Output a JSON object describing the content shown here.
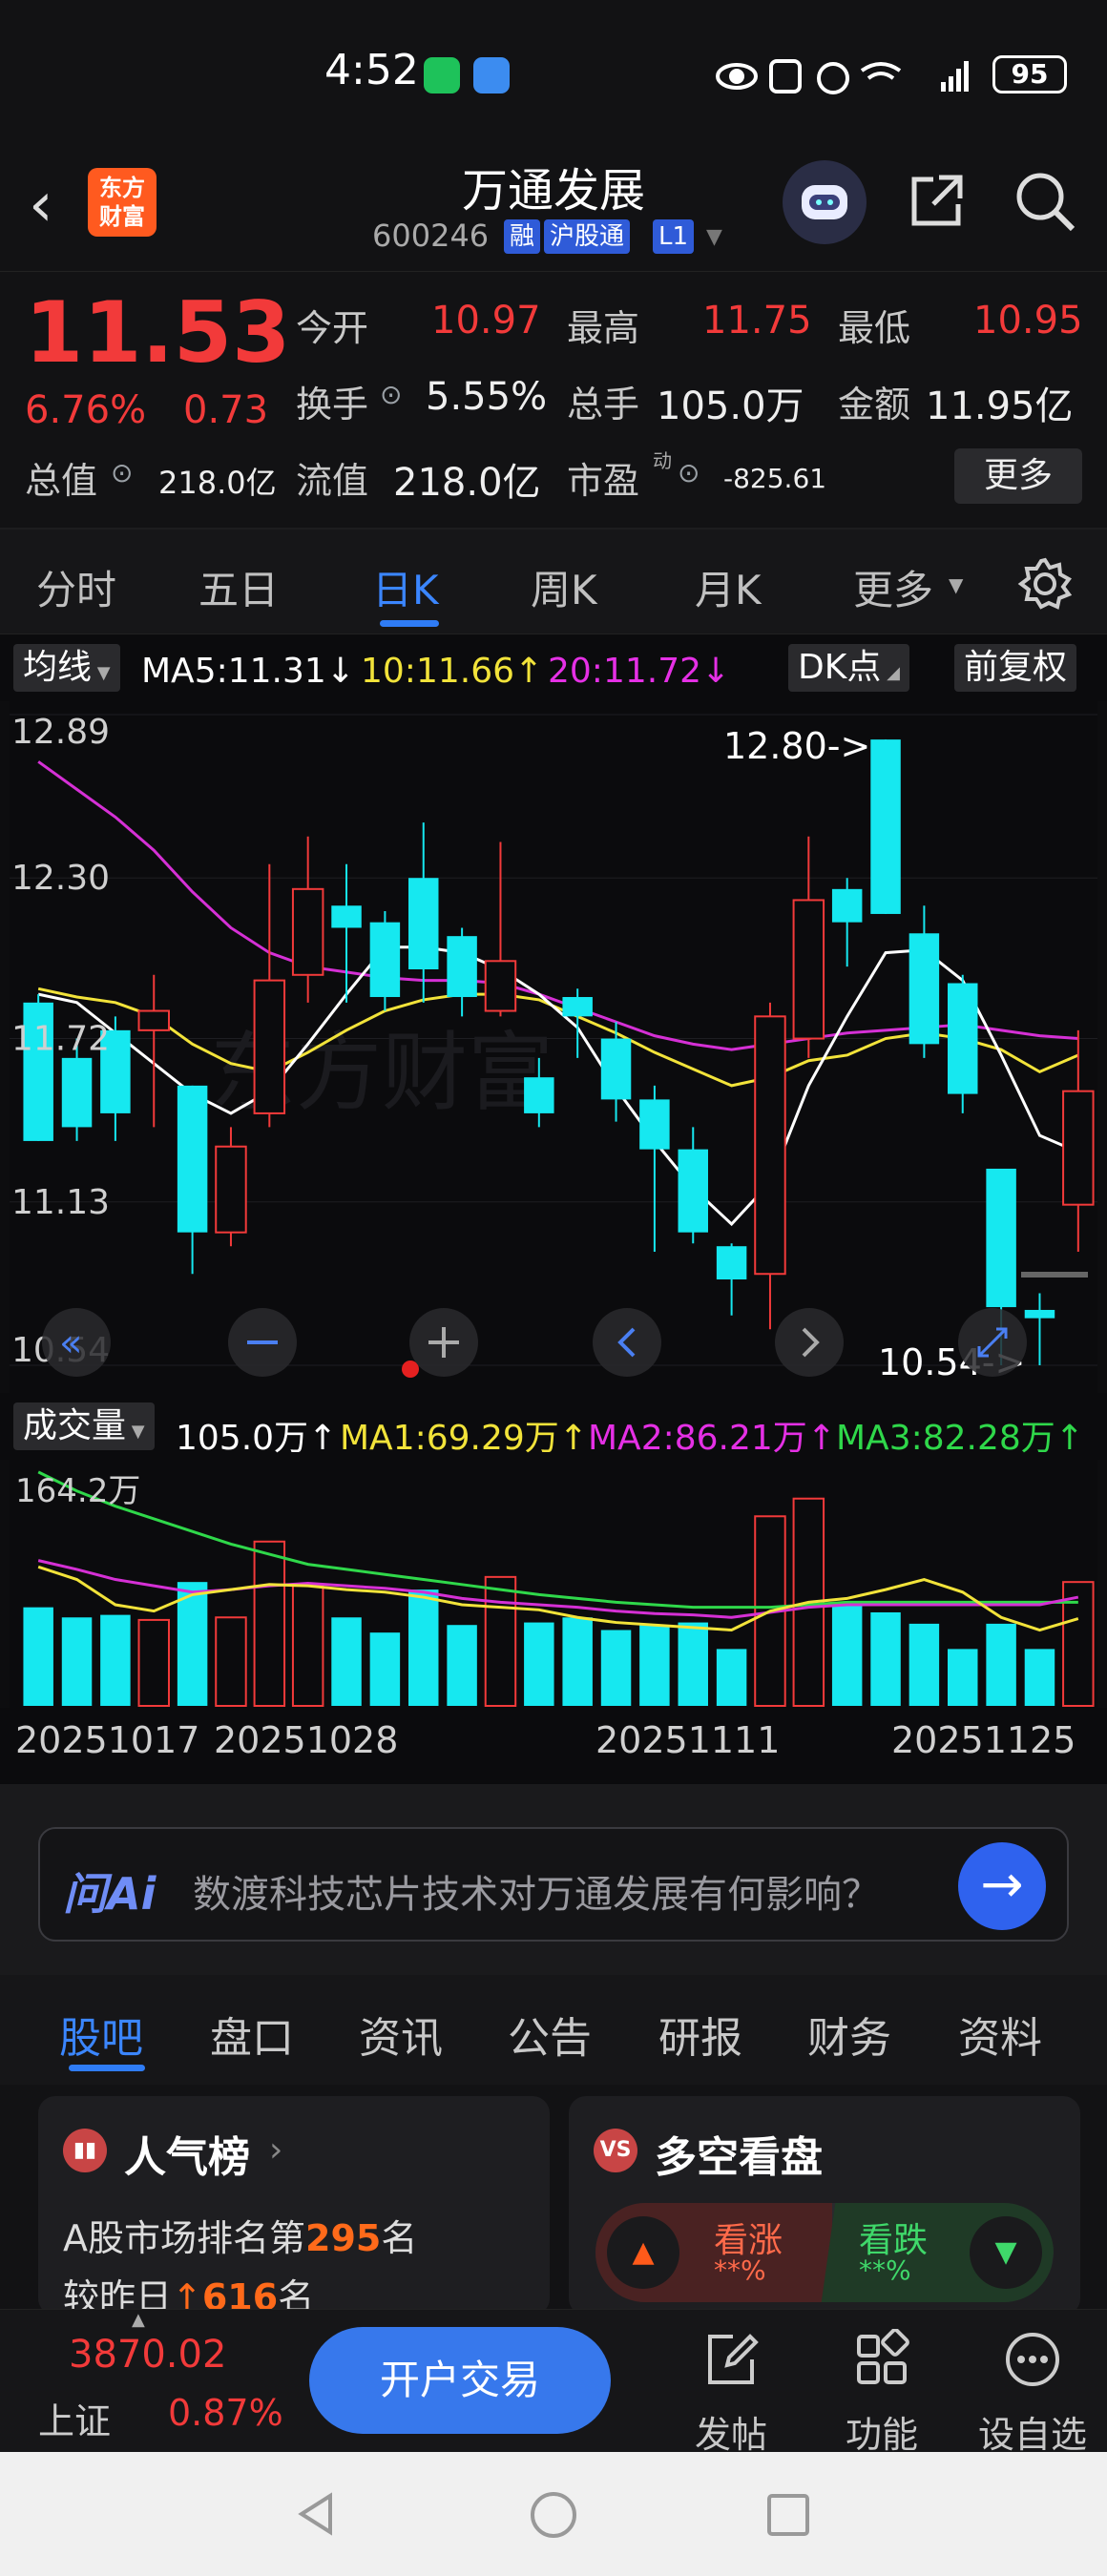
{
  "status_bar": {
    "time": "4:52",
    "battery": "95"
  },
  "header": {
    "logo_line1": "东方",
    "logo_line2": "财富",
    "stock_name": "万通发展",
    "stock_code": "600246",
    "tags": [
      "融",
      "沪股通",
      "L1"
    ]
  },
  "quote": {
    "price": "11.53",
    "change_pct": "6.76%",
    "change": "0.73",
    "open_label": "今开",
    "open": "10.97",
    "high_label": "最高",
    "high": "11.75",
    "low_label": "最低",
    "low": "10.95",
    "turnover_label": "换手",
    "turnover": "5.55%",
    "volume_label": "总手",
    "volume": "105.0万",
    "amount_label": "金额",
    "amount": "11.95亿",
    "mcap_label": "总值",
    "mcap": "218.0亿",
    "float_label": "流值",
    "float_cap": "218.0亿",
    "pe_label": "市盈",
    "pe_sup": "动",
    "pe": "-825.61",
    "more": "更多"
  },
  "period_tabs": [
    "分时",
    "五日",
    "日K",
    "周K",
    "月K",
    "更多"
  ],
  "ma_bar": {
    "selector": "均线",
    "ma5": "MA5:11.31↓",
    "ma10": "10:11.66↑",
    "ma20": "20:11.72↓",
    "dk": "DK点",
    "adjust": "前复权"
  },
  "vol_bar": {
    "selector": "成交量",
    "vol": "105.0万↑",
    "ma1": "MA1:69.29万↑",
    "ma2": "MA2:86.21万↑",
    "ma3": "MA3:82.28万↑"
  },
  "chart_data": {
    "type": "candlestick",
    "y_ticks": [
      "12.89",
      "12.30",
      "11.72",
      "11.13",
      "10.54"
    ],
    "ylim": [
      10.54,
      12.89
    ],
    "annotations": {
      "max_label": "12.80->",
      "min_label": "10.54->"
    },
    "candles": [
      [
        11.85,
        11.35,
        11.88,
        11.35
      ],
      [
        11.65,
        11.4,
        11.72,
        11.35
      ],
      [
        11.75,
        11.45,
        11.8,
        11.35
      ],
      [
        11.75,
        11.82,
        11.95,
        11.4
      ],
      [
        11.55,
        11.02,
        11.55,
        10.87
      ],
      [
        11.02,
        11.33,
        11.4,
        10.97
      ],
      [
        11.45,
        11.93,
        12.35,
        11.4
      ],
      [
        11.95,
        12.26,
        12.45,
        11.85
      ],
      [
        12.2,
        12.12,
        12.35,
        11.85
      ],
      [
        12.14,
        11.87,
        12.18,
        11.82
      ],
      [
        12.3,
        11.97,
        12.5,
        11.85
      ],
      [
        12.09,
        11.87,
        12.12,
        11.8
      ],
      [
        11.82,
        12.0,
        12.43,
        11.8
      ],
      [
        11.58,
        11.45,
        11.65,
        11.4
      ],
      [
        11.87,
        11.8,
        11.9,
        11.65
      ],
      [
        11.72,
        11.5,
        11.78,
        11.42
      ],
      [
        11.5,
        11.32,
        11.55,
        10.95
      ],
      [
        11.32,
        11.02,
        11.4,
        10.98
      ],
      [
        10.97,
        10.85,
        10.98,
        10.72
      ],
      [
        10.87,
        11.8,
        11.85,
        10.67
      ],
      [
        11.72,
        12.22,
        12.45,
        11.65
      ],
      [
        12.26,
        12.14,
        12.3,
        11.98
      ],
      [
        12.8,
        12.17,
        12.8,
        12.17
      ],
      [
        12.1,
        11.7,
        12.2,
        11.65
      ],
      [
        11.92,
        11.52,
        11.95,
        11.45
      ],
      [
        11.25,
        10.75,
        11.25,
        10.54
      ],
      [
        10.74,
        10.71,
        10.8,
        10.54
      ],
      [
        11.12,
        11.53,
        11.75,
        10.95
      ]
    ],
    "ma5": [
      11.88,
      11.85,
      11.74,
      11.63,
      11.52,
      11.45,
      11.53,
      11.7,
      11.88,
      12.05,
      12.05,
      12.03,
      11.97,
      11.88,
      11.76,
      11.54,
      11.35,
      11.18,
      11.05,
      11.2,
      11.55,
      11.8,
      12.03,
      12.04,
      11.93,
      11.66,
      11.37,
      11.31
    ],
    "ma10": [
      11.9,
      11.87,
      11.85,
      11.8,
      11.7,
      11.63,
      11.6,
      11.67,
      11.75,
      11.82,
      11.86,
      11.88,
      11.88,
      11.86,
      11.8,
      11.74,
      11.67,
      11.61,
      11.55,
      11.58,
      11.64,
      11.66,
      11.72,
      11.74,
      11.72,
      11.68,
      11.6,
      11.66
    ],
    "ma20": [
      12.72,
      12.62,
      12.52,
      12.4,
      12.25,
      12.12,
      12.03,
      11.98,
      11.96,
      11.94,
      11.93,
      11.93,
      11.92,
      11.88,
      11.83,
      11.78,
      11.73,
      11.7,
      11.68,
      11.7,
      11.72,
      11.74,
      11.75,
      11.76,
      11.77,
      11.75,
      11.73,
      11.72
    ],
    "volume_max_label": "164.2万",
    "volumes": [
      78,
      70,
      72,
      68,
      98,
      70,
      130,
      95,
      70,
      58,
      92,
      64,
      102,
      66,
      70,
      60,
      64,
      66,
      45,
      150,
      164,
      80,
      74,
      65,
      45,
      65,
      45,
      98
    ],
    "vol_ma1": [
      110,
      100,
      80,
      75,
      88,
      92,
      96,
      95,
      92,
      90,
      86,
      80,
      78,
      76,
      70,
      66,
      64,
      62,
      60,
      75,
      82,
      85,
      92,
      100,
      90,
      70,
      60,
      69
    ],
    "vol_ma2": [
      115,
      108,
      100,
      95,
      90,
      92,
      95,
      97,
      95,
      93,
      90,
      85,
      82,
      80,
      78,
      75,
      73,
      72,
      70,
      74,
      78,
      80,
      80,
      80,
      80,
      80,
      80,
      86
    ],
    "vol_ma3": [
      185,
      170,
      158,
      148,
      138,
      128,
      120,
      112,
      108,
      104,
      100,
      96,
      92,
      88,
      85,
      82,
      80,
      78,
      78,
      78,
      80,
      82,
      82,
      82,
      82,
      82,
      82,
      82
    ],
    "x_labels": [
      "20251017",
      "20251028",
      "20251111",
      "20251125"
    ]
  },
  "ai": {
    "logo": "问Ai",
    "prompt": "数渡科技芯片技术对万通发展有何影响？"
  },
  "content_tabs": [
    "股吧",
    "盘口",
    "资讯",
    "公告",
    "研报",
    "财务",
    "资料"
  ],
  "popularity_card": {
    "title": "人气榜",
    "line1_prefix": "A股市场排名第",
    "rank": "295",
    "line1_suffix": "名",
    "line2_prefix": "较昨日",
    "change": "616",
    "line2_suffix": "名"
  },
  "sentiment_card": {
    "title": "多空看盘",
    "up_label": "看涨",
    "up_value": "**%",
    "down_label": "看跌",
    "down_value": "**%"
  },
  "bottom_bar": {
    "index_value": "3870.02",
    "index_name": "上证",
    "index_pct": "0.87%",
    "open_trade": "开户交易",
    "post": "发帖",
    "functions": "功能",
    "add_fav": "设自选"
  }
}
